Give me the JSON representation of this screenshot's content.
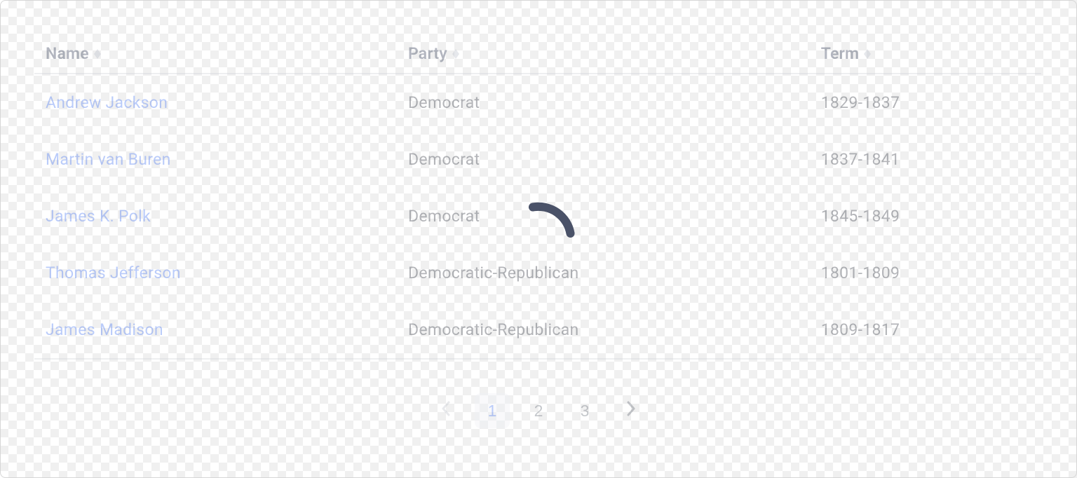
{
  "table": {
    "columns": {
      "name": "Name",
      "party": "Party",
      "term": "Term"
    },
    "rows": [
      {
        "name": "Andrew Jackson",
        "party": "Democrat",
        "term": "1829-1837"
      },
      {
        "name": "Martin van Buren",
        "party": "Democrat",
        "term": "1837-1841"
      },
      {
        "name": "James K. Polk",
        "party": "Democrat",
        "term": "1845-1849"
      },
      {
        "name": "Thomas Jefferson",
        "party": "Democratic-Republican",
        "term": "1801-1809"
      },
      {
        "name": "James Madison",
        "party": "Democratic-Republican",
        "term": "1809-1817"
      }
    ]
  },
  "pagination": {
    "pages": [
      "1",
      "2",
      "3"
    ],
    "current": "1"
  },
  "state": {
    "loading": true
  }
}
